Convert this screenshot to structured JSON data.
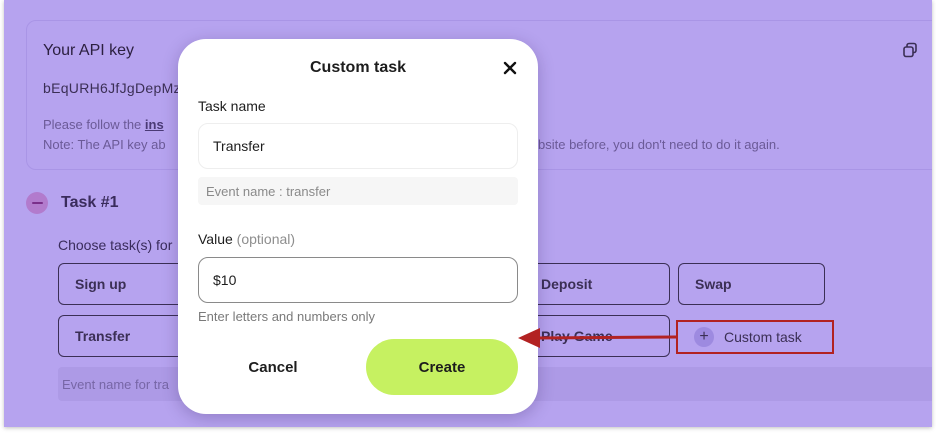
{
  "background": {
    "api_title": "Your API key",
    "api_key": "bEqURH6JfJgDepMz",
    "note_prefix": "Please follow the ",
    "note_link": "ins",
    "note2_prefix": "Note: The API key ab",
    "note2_suffix": "bsite before, you don't need to do it again.",
    "task_title": "Task #1",
    "choose_label": "Choose task(s) for",
    "options": [
      "Sign up",
      "Deposit",
      "Swap",
      "Transfer",
      "Play Game"
    ],
    "custom_task_label": "Custom task",
    "event_bar_text": "Event name for tra"
  },
  "modal": {
    "title": "Custom task",
    "task_name_label": "Task name",
    "task_name_value": "Transfer",
    "event_name": "Event name : transfer",
    "value_label": "Value",
    "value_optional": "(optional)",
    "value_value": "$10",
    "hint": "Enter letters and numbers only",
    "cancel_label": "Cancel",
    "create_label": "Create"
  },
  "colors": {
    "overlay_bg": "#b6a3ef",
    "create_button": "#c6f161",
    "annotation_red": "#b22222"
  },
  "icons": {
    "copy": "copy-icon",
    "close": "close-icon",
    "plus": "plus-icon",
    "minus": "minus-icon",
    "arrow": "annotation-arrow"
  }
}
